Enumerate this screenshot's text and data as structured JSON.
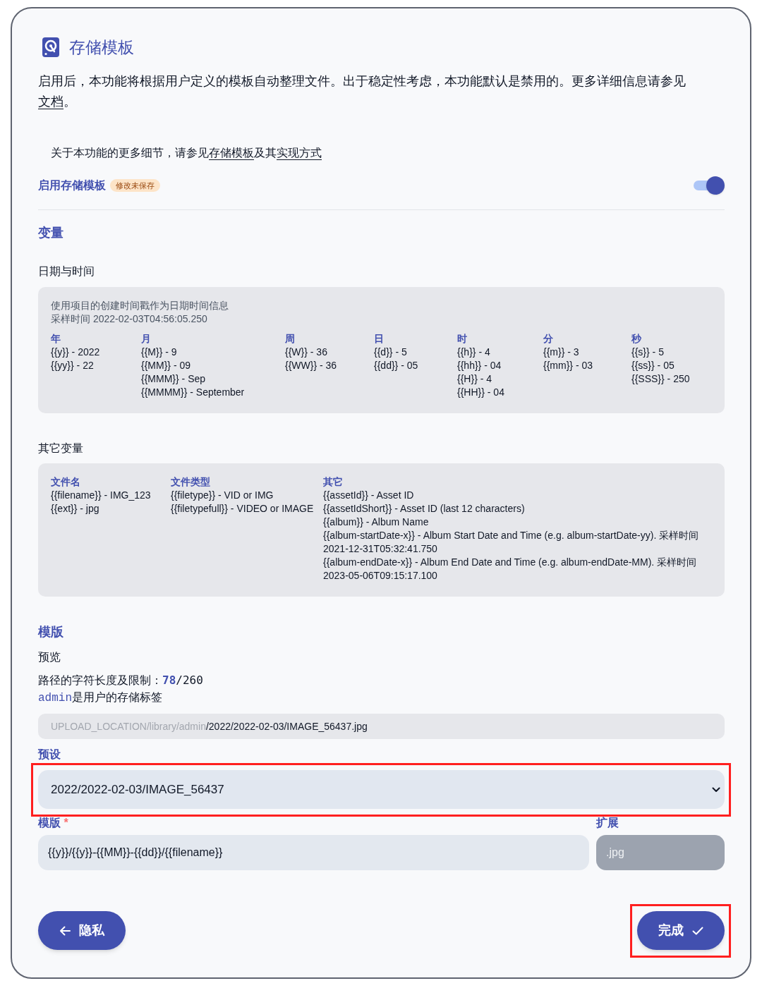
{
  "header": {
    "title": "存储模板"
  },
  "intro": [
    {
      "kind": "text",
      "text": "启用后，本功能将根据用户定义的模板自动整理文件。出于稳定性考虑，本功能默认是禁用的。更多详细信息请参见"
    },
    {
      "kind": "link",
      "text": "文档"
    },
    {
      "kind": "text",
      "text": "。"
    }
  ],
  "details": [
    {
      "kind": "text",
      "text": "关于本功能的更多细节，请参见"
    },
    {
      "kind": "link",
      "text": "存储模板"
    },
    {
      "kind": "text",
      "text": "及其"
    },
    {
      "kind": "link",
      "text": "实现方式"
    }
  ],
  "enable": {
    "label": "启用存储模板",
    "badge": "修改未保存",
    "on": true
  },
  "variables": {
    "title": "变量",
    "datetime": {
      "title": "日期与时间",
      "description": "使用项目的创建时间戳作为日期时间信息",
      "sample": "采样时间 2022-02-03T04:56:05.250",
      "columns": [
        {
          "heading": "年",
          "items": [
            "{{y}} - 2022",
            "{{yy}} - 22"
          ]
        },
        {
          "heading": "月",
          "items": [
            "{{M}} - 9",
            "{{MM}} - 09",
            "{{MMM}} - Sep",
            "{{MMMM}} - September"
          ]
        },
        {
          "heading": "周",
          "items": [
            "{{W}} - 36",
            "{{WW}} - 36"
          ]
        },
        {
          "heading": "日",
          "items": [
            "{{d}} - 5",
            "{{dd}} - 05"
          ]
        },
        {
          "heading": "时",
          "items": [
            "{{h}} - 4",
            "{{hh}} - 04",
            "{{H}} - 4",
            "{{HH}} - 04"
          ]
        },
        {
          "heading": "分",
          "items": [
            "{{m}} - 3",
            "{{mm}} - 03"
          ]
        },
        {
          "heading": "秒",
          "items": [
            "{{s}} - 5",
            "{{ss}} - 05",
            "{{SSS}} - 250"
          ]
        }
      ]
    },
    "other": {
      "title": "其它变量",
      "columns": [
        {
          "heading": "文件名",
          "items": [
            "{{filename}} - IMG_123",
            "{{ext}} - jpg"
          ]
        },
        {
          "heading": "文件类型",
          "items": [
            "{{filetype}} - VID or IMG",
            "{{filetypefull}} - VIDEO or IMAGE"
          ]
        },
        {
          "heading": "其它",
          "items": [
            "{{assetId}} - Asset ID",
            "{{assetIdShort}} - Asset ID (last 12 characters)",
            "{{album}} - Album Name",
            "{{album-startDate-x}} - Album Start Date and Time (e.g. album-startDate-yy). 采样时间 2021-12-31T05:32:41.750",
            "{{album-endDate-x}} - Album End Date and Time (e.g. album-endDate-MM). 采样时间 2023-05-06T09:15:17.100"
          ]
        }
      ]
    }
  },
  "template": {
    "title": "模版",
    "preview_label": "预览",
    "length": {
      "label": "路径的字符长度及限制：",
      "current": "78",
      "limit": "/260"
    },
    "storage_label": {
      "tag": "admin",
      "text": "是用户的存储标签"
    },
    "preview": {
      "prefix": "UPLOAD_LOCATION/library/admin",
      "path": "/2022/2022-02-03/IMAGE_56437.jpg"
    },
    "preset": {
      "label": "预设",
      "value": "2022/2022-02-03/IMAGE_56437",
      "highlighted": true
    },
    "template_field": {
      "label": "模版",
      "required_mark": "*",
      "value": "{{y}}/{{y}}-{{MM}}-{{dd}}/{{filename}}"
    },
    "extension": {
      "label": "扩展",
      "value": ".jpg",
      "disabled": true
    }
  },
  "buttons": [
    {
      "kind": "back",
      "label": "隐私",
      "highlighted": false
    },
    {
      "kind": "done",
      "label": "完成",
      "highlighted": true
    }
  ]
}
